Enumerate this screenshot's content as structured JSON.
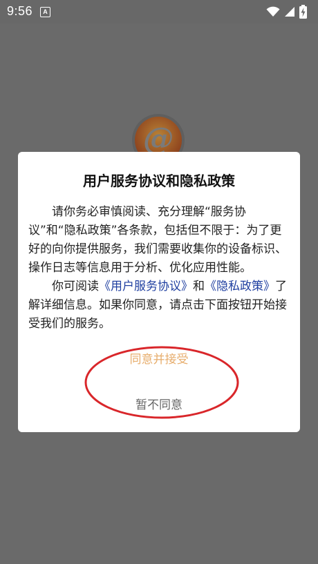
{
  "status_bar": {
    "time": "9:56",
    "notification_icon_letter": "A",
    "icons": [
      "wifi-icon",
      "cellular-icon",
      "battery-charging-icon"
    ]
  },
  "colors": {
    "backdrop": "#6a6a6a",
    "dialog_bg": "#ffffff",
    "link": "#1f3fa0",
    "agree": "#e7ad6c",
    "disagree": "#666666",
    "annotation_circle": "#d9262a",
    "logo_gradient": [
      "#f0b431",
      "#c0491c"
    ]
  },
  "background_app": {
    "logo_icon": "at-sign-logo-icon"
  },
  "dialog": {
    "title": "用户服务协议和隐私政策",
    "paragraph1": "请你务必审慎阅读、充分理解“服务协议”和“隐私政策”各条款，包括但不限于：为了更好的向你提供服务，我们需要收集你的设备标识、操作日志等信息用于分析、优化应用性能。",
    "paragraph2": {
      "prefix": "你可阅读",
      "link_user_agreement": "《用户服务协议》",
      "and": "和",
      "link_privacy_policy": "《隐私政策》",
      "suffix": "了解详细信息。如果你同意，请点击下面按钮开始接受我们的服务。"
    },
    "agree_label": "同意并接受",
    "disagree_label": "暂不同意"
  }
}
